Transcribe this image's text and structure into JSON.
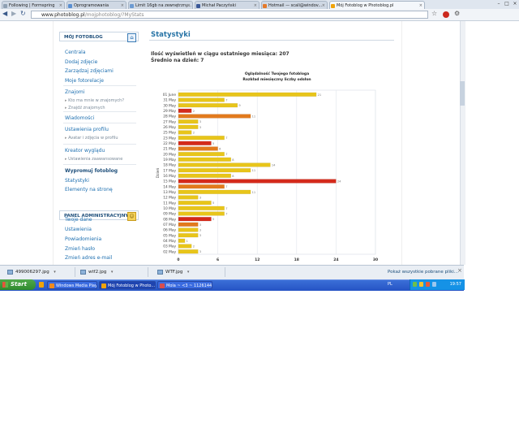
{
  "browser": {
    "tabs": [
      {
        "label": "Following | Formspring",
        "icon_color": "#8fa0b3"
      },
      {
        "label": "Oprogramowania",
        "icon_color": "#5a8fd1"
      },
      {
        "label": "Limit 16gb na zewnętrzny...",
        "icon_color": "#6c9bd2"
      },
      {
        "label": "Michał Paczyński",
        "icon_color": "#3b5998"
      },
      {
        "label": "Hotmail — scali@windov...",
        "icon_color": "#e47a2b"
      },
      {
        "label": "Mój Fotoblog w Photoblog.pl",
        "icon_color": "#f0a30a"
      }
    ],
    "url_domain": "www.photoblog.pl",
    "url_path": "/mojphotoblog/?MyStats",
    "nav_icons": [
      "back-icon",
      "forward-icon",
      "reload-icon",
      "star-icon",
      "stop-icon",
      "wrench-icon"
    ]
  },
  "sidebar": {
    "panel1_title": "MÓJ FOTOBLOG",
    "panel1_icon": "home-icon",
    "items": [
      {
        "label": "Centrala",
        "kind": "item"
      },
      {
        "label": "Dodaj zdjęcie",
        "kind": "item"
      },
      {
        "label": "Zarządzaj zdjęciami",
        "kind": "item"
      },
      {
        "label": "Moje fotorelacje",
        "kind": "item"
      },
      {
        "label": "Znajomi",
        "kind": "item"
      },
      {
        "label": "Kto ma mnie w znajomych?",
        "kind": "sub"
      },
      {
        "label": "Znajdź znajomych",
        "kind": "sub"
      },
      {
        "label": "Wiadomości",
        "kind": "item"
      },
      {
        "label": "Ustawienia profilu",
        "kind": "item"
      },
      {
        "label": "Avatar i zdjęcia w profilu",
        "kind": "sub"
      },
      {
        "label": "Kreator wyglądu",
        "kind": "item"
      },
      {
        "label": "Ustawienia zaawansowane",
        "kind": "sub"
      },
      {
        "label": "Wypromuj fotoblog",
        "kind": "bold"
      },
      {
        "label": "Statystyki",
        "kind": "item"
      },
      {
        "label": "Elementy na stronę",
        "kind": "item"
      }
    ],
    "panel2_title": "PANEL ADMINISTRACYJNY",
    "panel2_icon": "admin-icon",
    "items2": [
      {
        "label": "Twoje dane"
      },
      {
        "label": "Ustawienia"
      },
      {
        "label": "Powiadomienia"
      },
      {
        "label": "Zmień hasło"
      },
      {
        "label": "Zmień adres e-mail"
      }
    ]
  },
  "main": {
    "title": "Statystyki",
    "views_label": "Ilość wyświetleń w ciągu ostatniego miesiąca: 207",
    "avg_label": "Średnio na dzień: 7"
  },
  "chart_data": {
    "type": "bar",
    "orientation": "horizontal",
    "title": "Oglądalność Twojego fotobloga",
    "subtitle": "Rozkład miesięczny liczby odsłon",
    "xlabel": "",
    "ylabel": "Dzień",
    "xlim": [
      0,
      30
    ],
    "xticks": [
      0,
      6,
      12,
      18,
      24,
      30
    ],
    "grid": true,
    "colors": {
      "high": "#e8c51a",
      "mid": "#e27a1d",
      "low": "#d42a1b"
    },
    "categories": [
      "01 June",
      "31 May",
      "30 May",
      "29 May",
      "28 May",
      "27 May",
      "26 May",
      "25 May",
      "23 May",
      "22 May",
      "21 May",
      "20 May",
      "19 May",
      "18 May",
      "17 May",
      "16 May",
      "15 May",
      "14 May",
      "13 May",
      "12 May",
      "11 May",
      "10 May",
      "09 May",
      "08 May",
      "07 May",
      "06 May",
      "05 May",
      "04 May",
      "03 May",
      "02 May"
    ],
    "values": [
      21,
      7,
      9,
      2,
      11,
      3,
      3,
      2,
      7,
      5,
      6,
      7,
      8,
      14,
      11,
      8,
      24,
      7,
      11,
      3,
      5,
      7,
      7,
      5,
      3,
      3,
      3,
      1,
      2,
      3
    ],
    "bar_colors": [
      "high",
      "high",
      "high",
      "low",
      "mid",
      "high",
      "high",
      "high",
      "high",
      "low",
      "mid",
      "high",
      "high",
      "high",
      "high",
      "high",
      "low",
      "mid",
      "high",
      "high",
      "high",
      "high",
      "high",
      "low",
      "mid",
      "high",
      "high",
      "high",
      "high",
      "high"
    ]
  },
  "downloads": [
    {
      "name": "499006297.jpg"
    },
    {
      "name": "wtf2.jpg"
    },
    {
      "name": "WTF.jpg"
    }
  ],
  "downloads_showall": "Pokaż wszystkie pobrane pliki...",
  "taskbar": {
    "start_label": "Start",
    "tasks": [
      {
        "label": "Windows Media Player",
        "icon_color": "#f08a1c"
      },
      {
        "label": "Mój Fotoblog w Photo...",
        "icon_color": "#f0a30a"
      },
      {
        "label": "Mola ~ <3 ~ 11261449",
        "icon_color": "#d84d4d"
      }
    ],
    "lang": "PL",
    "clock": "19:57"
  }
}
